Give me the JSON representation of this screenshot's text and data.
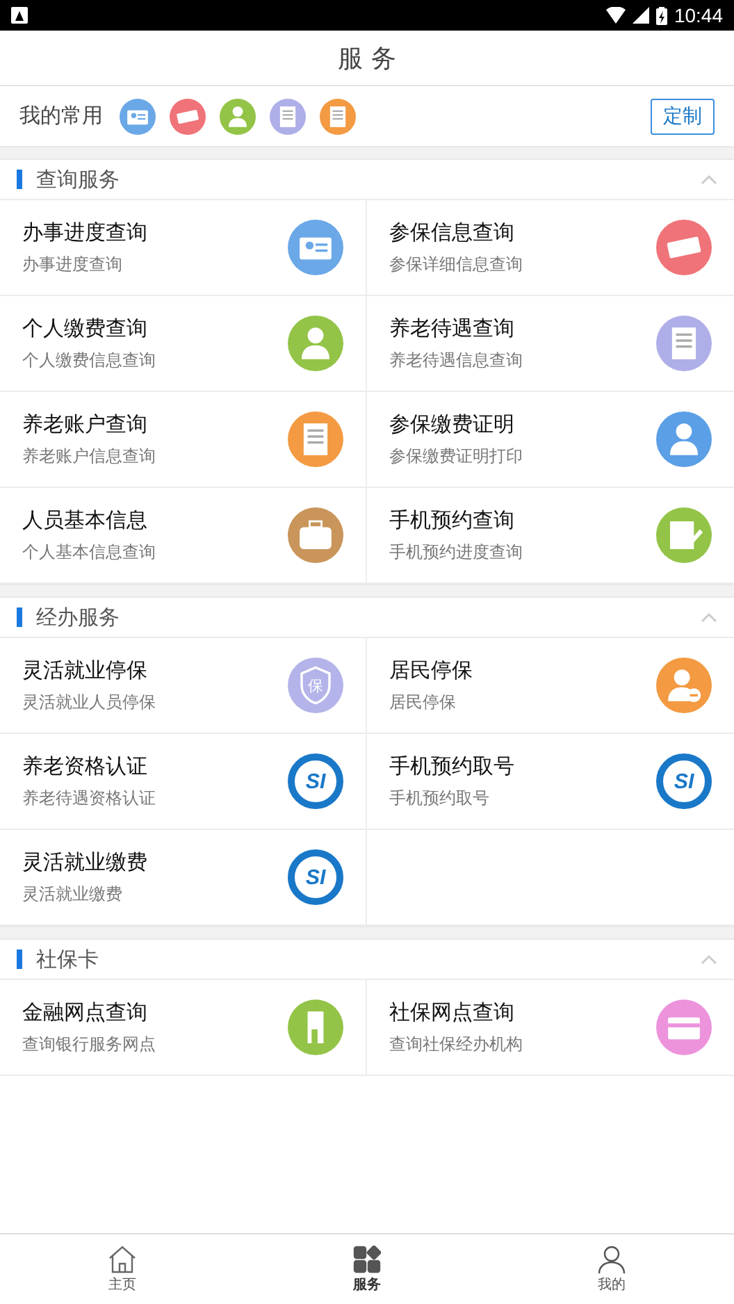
{
  "status_bar": {
    "time": "10:44"
  },
  "header": {
    "title": "服 务"
  },
  "favorites": {
    "label": "我的常用",
    "button": "定制",
    "items": [
      {
        "color": "#6aa8e8"
      },
      {
        "color": "#ef7378"
      },
      {
        "color": "#93c447"
      },
      {
        "color": "#aeaee8"
      },
      {
        "color": "#f39a42"
      }
    ]
  },
  "sections": [
    {
      "title": "查询服务",
      "expanded": true,
      "items": [
        {
          "title": "办事进度查询",
          "subtitle": "办事进度查询",
          "color": "#6aa8e8"
        },
        {
          "title": "参保信息查询",
          "subtitle": "参保详细信息查询",
          "color": "#ef7378"
        },
        {
          "title": "个人缴费查询",
          "subtitle": "个人缴费信息查询",
          "color": "#93c447"
        },
        {
          "title": "养老待遇查询",
          "subtitle": "养老待遇信息查询",
          "color": "#aeaee8"
        },
        {
          "title": "养老账户查询",
          "subtitle": "养老账户信息查询",
          "color": "#f39a42"
        },
        {
          "title": "参保缴费证明",
          "subtitle": "参保缴费证明打印",
          "color": "#5b9fe6"
        },
        {
          "title": "人员基本信息",
          "subtitle": "个人基本信息查询",
          "color": "#c9955a"
        },
        {
          "title": "手机预约查询",
          "subtitle": "手机预约进度查询",
          "color": "#93c447"
        }
      ]
    },
    {
      "title": "经办服务",
      "expanded": true,
      "items": [
        {
          "title": "灵活就业停保",
          "subtitle": "灵活就业人员停保",
          "color": "#b4b4ea",
          "logo_text": "保"
        },
        {
          "title": "居民停保",
          "subtitle": "居民停保",
          "color": "#f39a42"
        },
        {
          "title": "养老资格认证",
          "subtitle": "养老待遇资格认证",
          "color": "#1a78c8",
          "logo_text": "SI"
        },
        {
          "title": "手机预约取号",
          "subtitle": "手机预约取号",
          "color": "#1a78c8",
          "logo_text": "SI"
        },
        {
          "title": "灵活就业缴费",
          "subtitle": "灵活就业缴费",
          "color": "#1a78c8",
          "logo_text": "SI"
        }
      ]
    },
    {
      "title": "社保卡",
      "expanded": true,
      "items": [
        {
          "title": "金融网点查询",
          "subtitle": "查询银行服务网点",
          "color": "#93c447"
        },
        {
          "title": "社保网点查询",
          "subtitle": "查询社保经办机构",
          "color": "#ec93dc"
        }
      ]
    }
  ],
  "bottom_nav": [
    {
      "label": "主页",
      "selected": false
    },
    {
      "label": "服务",
      "selected": true
    },
    {
      "label": "我的",
      "selected": false
    }
  ]
}
